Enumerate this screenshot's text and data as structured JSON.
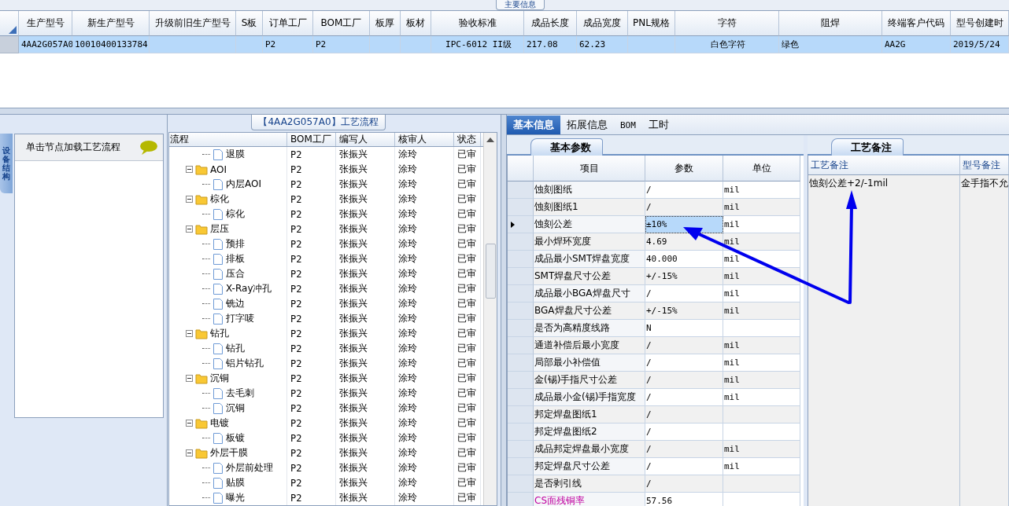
{
  "main_info": {
    "tab_label": "主要信息",
    "columns": [
      "生产型号",
      "新生产型号",
      "升级前旧生产型号",
      "S板",
      "订单工厂",
      "BOM工厂",
      "板厚",
      "板材",
      "验收标准",
      "成品长度",
      "成品宽度",
      "PNL规格",
      "字符",
      "阻焊",
      "终端客户代码",
      "型号创建时"
    ],
    "rows": [
      {
        "selected": true,
        "cells": [
          "4AA2G057A0",
          "10010400133784",
          null,
          null,
          "P2",
          "P2",
          null,
          null,
          "IPC-6012 II级",
          "217.08",
          "62.23",
          null,
          "白色字符",
          "绿色",
          "AA2G",
          "2019/5/24"
        ]
      }
    ]
  },
  "side_tab": {
    "label": "设备结构"
  },
  "node_panel": {
    "hint": "单击节点加载工艺流程"
  },
  "flow": {
    "caption": "【4AA2G057A0】工艺流程",
    "columns": [
      "流程",
      "BOM工厂",
      "编写人",
      "核审人",
      "状态"
    ],
    "continued": [
      {
        "label": "退膜",
        "bom": "P2",
        "writer": "张振兴",
        "reviewer": "涂玲",
        "status": "已审"
      }
    ],
    "nodes": [
      {
        "label": "AOI",
        "expanded": true,
        "bom": "P2",
        "writer": "张振兴",
        "reviewer": "涂玲",
        "status": "已审",
        "children": [
          {
            "label": "内层AOI",
            "bom": "P2",
            "writer": "张振兴",
            "reviewer": "涂玲",
            "status": "已审"
          }
        ]
      },
      {
        "label": "棕化",
        "expanded": true,
        "bom": "P2",
        "writer": "张振兴",
        "reviewer": "涂玲",
        "status": "已审",
        "children": [
          {
            "label": "棕化",
            "bom": "P2",
            "writer": "张振兴",
            "reviewer": "涂玲",
            "status": "已审"
          }
        ]
      },
      {
        "label": "层压",
        "expanded": true,
        "bom": "P2",
        "writer": "张振兴",
        "reviewer": "涂玲",
        "status": "已审",
        "children": [
          {
            "label": "预排",
            "bom": "P2",
            "writer": "张振兴",
            "reviewer": "涂玲",
            "status": "已审"
          },
          {
            "label": "排板",
            "bom": "P2",
            "writer": "张振兴",
            "reviewer": "涂玲",
            "status": "已审"
          },
          {
            "label": "压合",
            "bom": "P2",
            "writer": "张振兴",
            "reviewer": "涂玲",
            "status": "已审"
          },
          {
            "label": "X-Ray冲孔",
            "bom": "P2",
            "writer": "张振兴",
            "reviewer": "涂玲",
            "status": "已审"
          },
          {
            "label": "铣边",
            "bom": "P2",
            "writer": "张振兴",
            "reviewer": "涂玲",
            "status": "已审"
          },
          {
            "label": "打字唛",
            "bom": "P2",
            "writer": "张振兴",
            "reviewer": "涂玲",
            "status": "已审"
          }
        ]
      },
      {
        "label": "钻孔",
        "expanded": true,
        "bom": "P2",
        "writer": "张振兴",
        "reviewer": "涂玲",
        "status": "已审",
        "children": [
          {
            "label": "钻孔",
            "bom": "P2",
            "writer": "张振兴",
            "reviewer": "涂玲",
            "status": "已审"
          },
          {
            "label": "铝片钻孔",
            "bom": "P2",
            "writer": "张振兴",
            "reviewer": "涂玲",
            "status": "已审"
          }
        ]
      },
      {
        "label": "沉铜",
        "expanded": true,
        "bom": "P2",
        "writer": "张振兴",
        "reviewer": "涂玲",
        "status": "已审",
        "children": [
          {
            "label": "去毛刺",
            "bom": "P2",
            "writer": "张振兴",
            "reviewer": "涂玲",
            "status": "已审"
          },
          {
            "label": "沉铜",
            "bom": "P2",
            "writer": "张振兴",
            "reviewer": "涂玲",
            "status": "已审"
          }
        ]
      },
      {
        "label": "电镀",
        "expanded": true,
        "bom": "P2",
        "writer": "张振兴",
        "reviewer": "涂玲",
        "status": "已审",
        "children": [
          {
            "label": "板镀",
            "bom": "P2",
            "writer": "张振兴",
            "reviewer": "涂玲",
            "status": "已审"
          }
        ]
      },
      {
        "label": "外层干膜",
        "expanded": true,
        "bom": "P2",
        "writer": "张振兴",
        "reviewer": "涂玲",
        "status": "已审",
        "children": [
          {
            "label": "外层前处理",
            "bom": "P2",
            "writer": "张振兴",
            "reviewer": "涂玲",
            "status": "已审"
          },
          {
            "label": "贴膜",
            "bom": "P2",
            "writer": "张振兴",
            "reviewer": "涂玲",
            "status": "已审"
          },
          {
            "label": "曝光",
            "bom": "P2",
            "writer": "张振兴",
            "reviewer": "涂玲",
            "status": "已审"
          }
        ]
      }
    ]
  },
  "info_tabs": [
    {
      "label": "基本信息",
      "selected": true
    },
    {
      "label": "拓展信息",
      "selected": false
    },
    {
      "label": "BOM",
      "selected": false
    },
    {
      "label": "工时",
      "selected": false
    }
  ],
  "params": {
    "tab_label": "基本参数",
    "columns": [
      "项目",
      "参数",
      "单位"
    ],
    "rows": [
      {
        "item": "蚀刻图纸",
        "value": "/",
        "unit": "mil",
        "current": false,
        "flagged": false
      },
      {
        "item": "蚀刻图纸1",
        "value": "/",
        "unit": "mil",
        "current": false,
        "flagged": false
      },
      {
        "item": "蚀刻公差",
        "value": "±10%",
        "unit": "mil",
        "current": true,
        "flagged": false
      },
      {
        "item": "最小焊环宽度",
        "value": "4.69",
        "unit": "mil",
        "current": false,
        "flagged": false
      },
      {
        "item": "成品最小SMT焊盘宽度",
        "value": "40.000",
        "unit": "mil",
        "current": false,
        "flagged": false
      },
      {
        "item": "SMT焊盘尺寸公差",
        "value": "+/-15%",
        "unit": "mil",
        "current": false,
        "flagged": false
      },
      {
        "item": "成品最小BGA焊盘尺寸",
        "value": "/",
        "unit": "mil",
        "current": false,
        "flagged": false
      },
      {
        "item": "BGA焊盘尺寸公差",
        "value": "+/-15%",
        "unit": "mil",
        "current": false,
        "flagged": false
      },
      {
        "item": "是否为高精度线路",
        "value": "N",
        "current": false,
        "flagged": false
      },
      {
        "item": "通道补偿后最小宽度",
        "value": "/",
        "unit": "mil",
        "current": false,
        "flagged": false
      },
      {
        "item": "局部最小补偿值",
        "value": "/",
        "unit": "mil",
        "current": false,
        "flagged": false
      },
      {
        "item": "金(锡)手指尺寸公差",
        "value": "/",
        "unit": "mil",
        "current": false,
        "flagged": false
      },
      {
        "item": "成品最小金(锡)手指宽度",
        "value": "/",
        "unit": "mil",
        "current": false,
        "flagged": false
      },
      {
        "item": "邦定焊盘图纸1",
        "value": "/",
        "current": false,
        "flagged": false
      },
      {
        "item": "邦定焊盘图纸2",
        "value": "/",
        "current": false,
        "flagged": false
      },
      {
        "item": "成品邦定焊盘最小宽度",
        "value": "/",
        "unit": "mil",
        "current": false,
        "flagged": false
      },
      {
        "item": "邦定焊盘尺寸公差",
        "value": "/",
        "unit": "mil",
        "current": false,
        "flagged": false
      },
      {
        "item": "是否剥引线",
        "value": "/",
        "current": false,
        "flagged": false
      },
      {
        "item": "CS面残铜率",
        "value": "57.56",
        "current": false,
        "flagged": true
      }
    ]
  },
  "remarks": {
    "tab_label": "工艺备注",
    "columns": [
      {
        "header": "工艺备注",
        "text": "蚀刻公差+2/-1mil"
      },
      {
        "header": "型号备注",
        "text": "金手指不允"
      }
    ]
  }
}
